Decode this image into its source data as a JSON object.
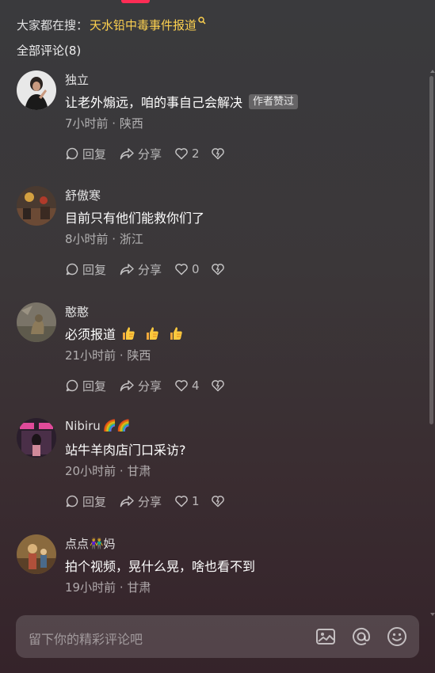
{
  "search_hint": {
    "prefix": "大家都在搜：",
    "keyword": "天水铅中毒事件报道"
  },
  "comment_count_title": "全部评论(8)",
  "comments": [
    {
      "author": "独立",
      "author_emoji": "",
      "text": "让老外煽远，咱的事自己会解决",
      "tag": "作者赞过",
      "meta": "7小时前 · 陕西",
      "reply_label": "回复",
      "share_label": "分享",
      "likes": "2"
    },
    {
      "author": "舒傲寒",
      "author_emoji": "",
      "text": "目前只有他们能救你们了",
      "tag": "",
      "meta": "8小时前 · 浙江",
      "reply_label": "回复",
      "share_label": "分享",
      "likes": "0"
    },
    {
      "author": "憨憨",
      "author_emoji": "",
      "text": "必须报道",
      "tag": "",
      "meta": "21小时前 · 陕西",
      "reply_label": "回复",
      "share_label": "分享",
      "likes": "4"
    },
    {
      "author": "Nibiru",
      "author_emoji": "🌈🌈",
      "text": "站牛羊肉店门口采访?",
      "tag": "",
      "meta": "20小时前 · 甘肃",
      "reply_label": "回复",
      "share_label": "分享",
      "likes": "1"
    },
    {
      "author": "点点",
      "author_emoji": "👫",
      "author_suffix": "妈",
      "text": "拍个视频，晃什么晃，啥也看不到",
      "tag": "",
      "meta": "19小时前 · 甘肃"
    }
  ],
  "input": {
    "placeholder": "留下你的精彩评论吧"
  },
  "icons": [
    "search-icon",
    "reply-icon",
    "share-icon",
    "heart-icon",
    "dislike-icon",
    "thumbs-up-emoji",
    "image-icon",
    "at-icon",
    "emoji-icon"
  ],
  "colors": {
    "accent": "#fe2c55",
    "keyword": "#fdd14f"
  }
}
